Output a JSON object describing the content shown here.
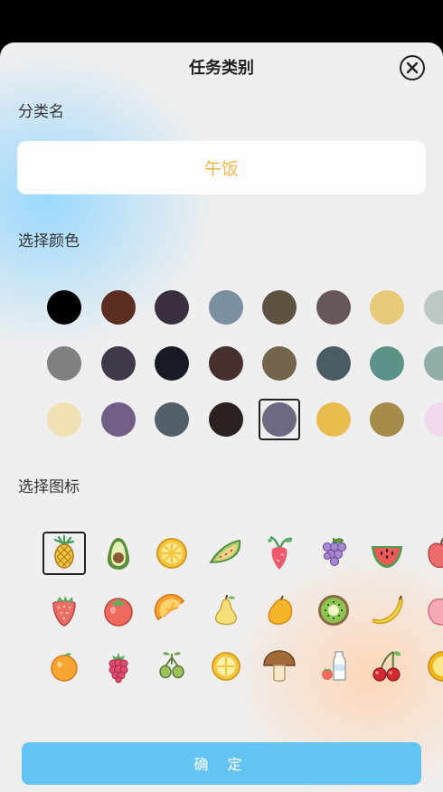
{
  "header": {
    "title": "任务类别"
  },
  "name_section": {
    "label": "分类名",
    "value": "午饭"
  },
  "color_section": {
    "label": "选择颜色",
    "selected_index": 20,
    "colors": [
      "#000000",
      "#5c2d21",
      "#3a2f3f",
      "#7c8fa0",
      "#5e5240",
      "#675757",
      "#e7c97a",
      "#bdc8c5",
      "#808080",
      "#41384a",
      "#181a24",
      "#45302d",
      "#73654c",
      "#4a5b63",
      "#5b9388",
      "#91aea8",
      "#f0e0b4",
      "#725f85",
      "#535f69",
      "#2b221f",
      "#6e6981",
      "#e9bd4d",
      "#a68c4a",
      "#efd9ea"
    ]
  },
  "icon_section": {
    "label": "选择图标",
    "selected_index": 0,
    "icons": [
      "pineapple-icon",
      "avocado-icon",
      "lemon-slice-icon",
      "melon-slice-icon",
      "radish-icon",
      "grapes-icon",
      "watermelon-icon",
      "apple-icon",
      "strawberry-icon",
      "tomato-icon",
      "orange-slice-icon",
      "pear-icon",
      "mango-icon",
      "kiwi-icon",
      "banana-icon",
      "peach-icon",
      "orange-icon",
      "raspberry-icon",
      "olives-icon",
      "lime-icon",
      "mushroom-icon",
      "milk-icon",
      "cherry-icon",
      "grapefruit-icon"
    ]
  },
  "confirm_button": {
    "label": "确 定"
  }
}
